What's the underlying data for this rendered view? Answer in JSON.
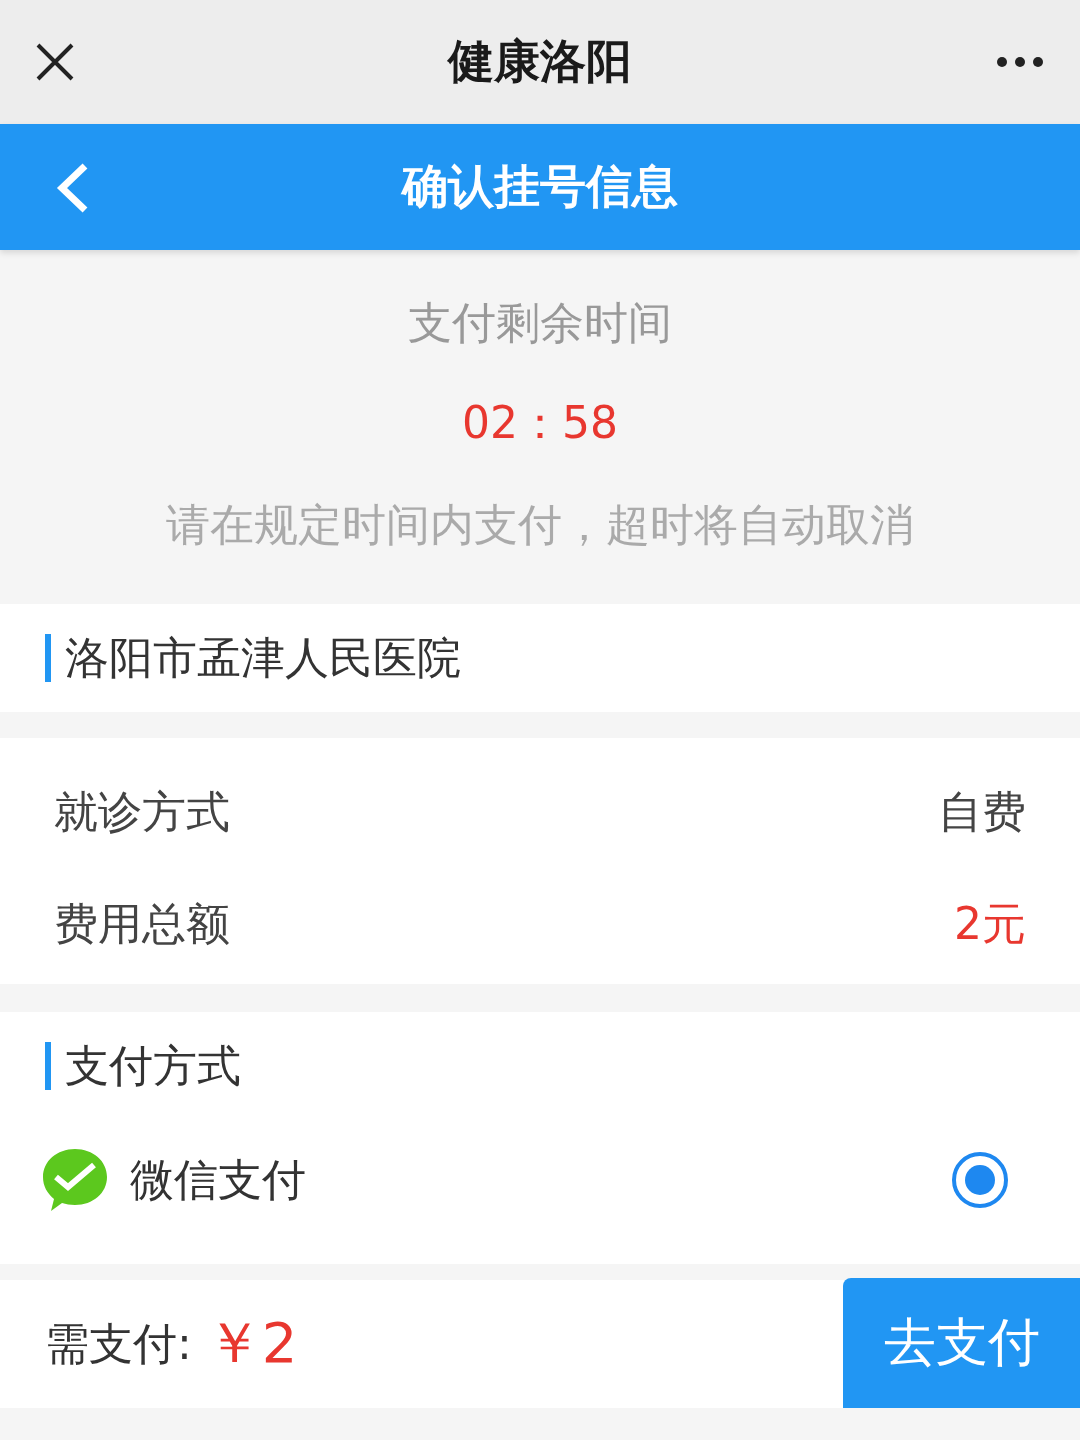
{
  "window": {
    "title": "健康洛阳"
  },
  "header": {
    "title": "确认挂号信息"
  },
  "countdown": {
    "label": "支付剩余时间",
    "time": "02：58",
    "notice": "请在规定时间内支付，超时将自动取消"
  },
  "hospital": {
    "name": "洛阳市孟津人民医院"
  },
  "details": [
    {
      "label": "就诊方式",
      "value": "自费",
      "kind": "plain"
    },
    {
      "label": "费用总额",
      "value": "2元",
      "kind": "amount"
    }
  ],
  "payment": {
    "title": "支付方式",
    "methods": [
      {
        "name": "微信支付",
        "selected": true
      }
    ]
  },
  "footer": {
    "label": "需支付:",
    "amount": "￥2",
    "button": "去支付"
  }
}
